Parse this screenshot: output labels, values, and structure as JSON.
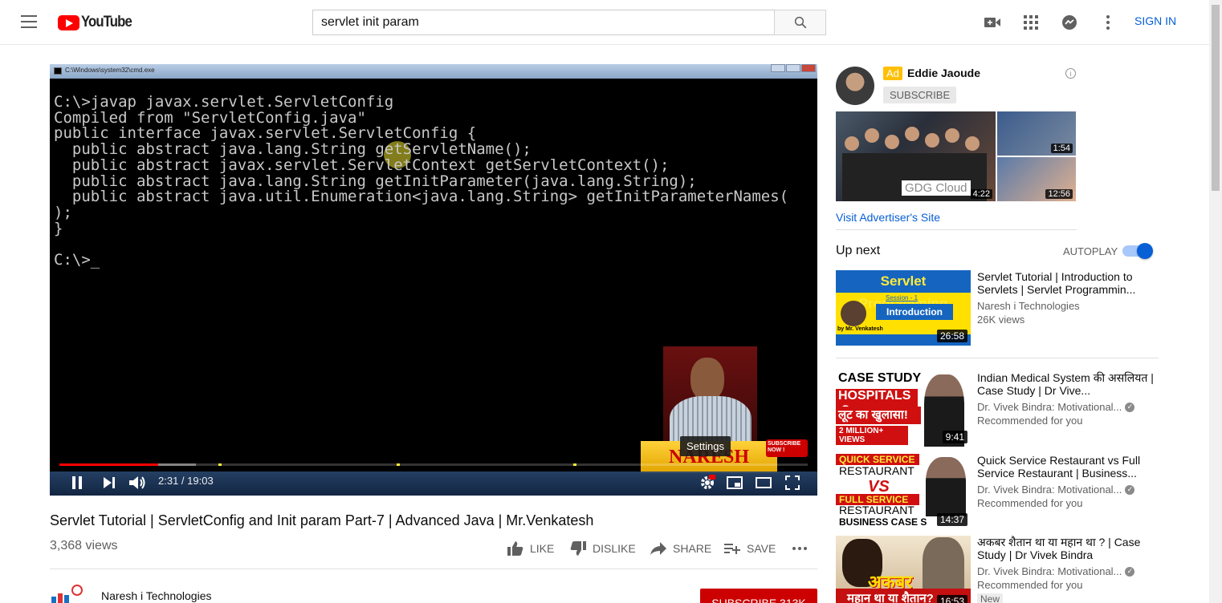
{
  "masthead": {
    "logo_text": "YouTube",
    "search_value": "servlet init param",
    "sign_in": "SIGN IN"
  },
  "player": {
    "window_title": "C:\\Windows\\system32\\cmd.exe",
    "console_lines": [
      "C:\\>javap javax.servlet.ServletConfig",
      "Compiled from \"ServletConfig.java\"",
      "public interface javax.servlet.ServletConfig {",
      "  public abstract java.lang.String getServletName();",
      "  public abstract javax.servlet.ServletContext getServletContext();",
      "  public abstract java.lang.String getInitParameter(java.lang.String);",
      "  public abstract java.util.Enumeration<java.lang.String> getInitParameterNames(",
      ");",
      "}",
      "",
      "C:\\>_"
    ],
    "banner_text": "NARESH",
    "stamp_text": "SUBSCRIBE NOW !",
    "tooltip": "Settings",
    "time": "2:31 / 19:03",
    "progress_fraction": 0.132
  },
  "video": {
    "title": "Servlet Tutorial | ServletConfig and Init param Part-7 | Advanced Java | Mr.Venkatesh",
    "views": "3,368 views",
    "like": "LIKE",
    "dislike": "DISLIKE",
    "share": "SHARE",
    "save": "SAVE"
  },
  "channel": {
    "name": "Naresh i Technologies",
    "subscribe": "SUBSCRIBE 313K"
  },
  "ad": {
    "badge": "Ad",
    "name": "Eddie Jaoude",
    "subscribe": "SUBSCRIBE",
    "durations": [
      "4:22",
      "1:54",
      "12:56"
    ],
    "thumb_text": "GDG Cloud",
    "visit": "Visit Advertiser's Site"
  },
  "upnext": {
    "label": "Up next",
    "autoplay": "AUTOPLAY",
    "autoplay_on": true
  },
  "recommendations": [
    {
      "title": "Servlet Tutorial | Introduction to Servlets | Servlet Programmin...",
      "channel": "Naresh i Technologies",
      "meta": "26K views",
      "duration": "26:58",
      "verified": false,
      "thumb_lines": [
        "Servlet Programming",
        "Session - 1",
        "Introduction",
        "by Mr. Venkatesh"
      ]
    },
    {
      "title": "Indian Medical System की असलियत | Case Study | Dr Vive...",
      "channel": "Dr. Vivek Bindra: Motivational...",
      "meta": "Recommended for you",
      "duration": "9:41",
      "verified": true,
      "thumb_lines": [
        "CASE STUDY",
        "HOSPITALS की",
        "लूट का खुलासा!",
        "2 MILLION+ VIEWS"
      ]
    },
    {
      "title": "Quick Service Restaurant vs Full Service Restaurant | Business...",
      "channel": "Dr. Vivek Bindra: Motivational...",
      "meta": "Recommended for you",
      "duration": "14:37",
      "verified": true,
      "thumb_lines": [
        "QUICK SERVICE",
        "RESTAURANT",
        "VS",
        "FULL SERVICE",
        "RESTAURANT",
        "BUSINESS CASE S"
      ]
    },
    {
      "title": "अकबर शैतान था या महान था ? | Case Study | Dr Vivek Bindra",
      "channel": "Dr. Vivek Bindra: Motivational...",
      "meta": "Recommended for you",
      "duration": "16:53",
      "verified": true,
      "badge": "New",
      "thumb_lines": [
        "अकबर",
        "महान था या शैतान?"
      ]
    }
  ]
}
